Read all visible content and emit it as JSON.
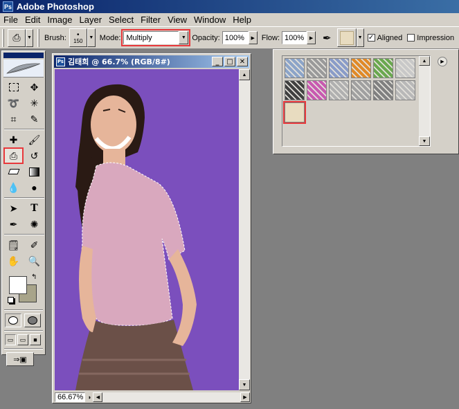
{
  "app": {
    "title": "Adobe Photoshop"
  },
  "menu": [
    "File",
    "Edit",
    "Image",
    "Layer",
    "Select",
    "Filter",
    "View",
    "Window",
    "Help"
  ],
  "options": {
    "brush_label": "Brush:",
    "brush_size": "150",
    "mode_label": "Mode:",
    "mode_value": "Multiply",
    "opacity_label": "Opacity:",
    "opacity_value": "100%",
    "flow_label": "Flow:",
    "flow_value": "100%",
    "aligned_label": "Aligned",
    "aligned_checked": true,
    "impressionist_label": "Impression",
    "impressionist_checked": false
  },
  "document": {
    "title": "김태희 @ 66.7% (RGB/8#)",
    "zoom": "66.67%"
  },
  "tools": [
    "marquee-icon",
    "move-icon",
    "lasso-icon",
    "magic-wand-icon",
    "crop-icon",
    "slice-icon",
    "healing-brush-icon",
    "brush-icon",
    "pattern-stamp-icon",
    "history-brush-icon",
    "eraser-icon",
    "gradient-icon",
    "blur-icon",
    "dodge-icon",
    "path-selection-icon",
    "type-icon",
    "pen-icon",
    "custom-shape-icon",
    "notes-icon",
    "eyedropper-icon",
    "hand-icon",
    "zoom-icon"
  ],
  "colors": {
    "foreground": "#ffffff",
    "background": "#a8a48a",
    "accent": "#e8383b",
    "canvas_bg": "#7b4fbd"
  },
  "patterns": {
    "swatches": [
      "#8ca4c8",
      "#9a9a9a",
      "#8a9cc8",
      "#e08a28",
      "#6aa84f",
      "#c8c8c8",
      "#404040",
      "#c85ab0",
      "#b0b0b0",
      "#a0a0a0",
      "#808080",
      "#b8b8b8",
      "#e8dcc0"
    ],
    "selected_index": 12
  }
}
